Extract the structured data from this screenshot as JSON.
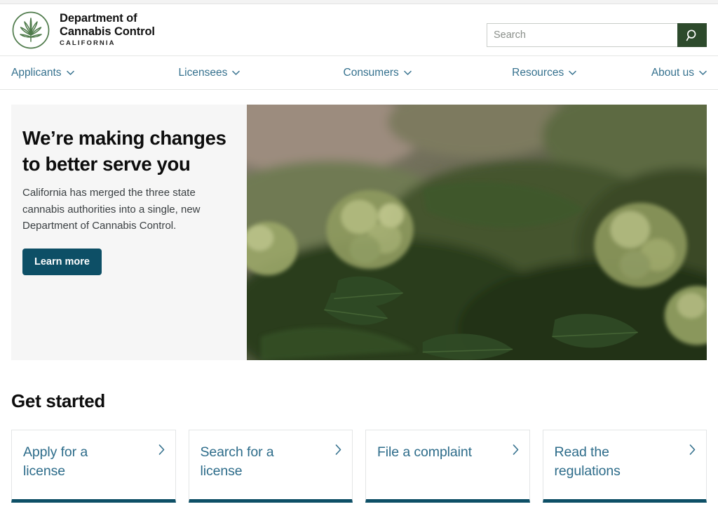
{
  "brand": {
    "logo_icon": "cannabis-leaf-circle-icon",
    "line1": "Department of",
    "line2": "Cannabis Control",
    "state": "CALIFORNIA"
  },
  "search": {
    "placeholder": "Search",
    "value": "",
    "button_icon": "search-icon",
    "button_color": "#2d4a2c"
  },
  "nav": {
    "items": [
      {
        "label": "Applicants",
        "icon": "chevron-down-icon"
      },
      {
        "label": "Licensees",
        "icon": "chevron-down-icon"
      },
      {
        "label": "Consumers",
        "icon": "chevron-down-icon"
      },
      {
        "label": "Resources",
        "icon": "chevron-down-icon"
      },
      {
        "label": "About us",
        "icon": "chevron-down-icon"
      }
    ],
    "link_color": "#35718e"
  },
  "hero": {
    "title": "We’re making changes to better serve you",
    "description": "California has merged the three state cannabis authorities into a single, new Department of Cannabis Control.",
    "button_label": "Learn more",
    "button_color": "#0d4f66",
    "image_alt": "cannabis-plant-photo"
  },
  "get_started": {
    "heading": "Get started",
    "accent_color": "#0d4f66",
    "cards": [
      {
        "label": "Apply for a license",
        "icon": "chevron-right-icon"
      },
      {
        "label": "Search for a license",
        "icon": "chevron-right-icon"
      },
      {
        "label": "File a complaint",
        "icon": "chevron-right-icon"
      },
      {
        "label": "Read the regulations",
        "icon": "chevron-right-icon"
      }
    ]
  }
}
